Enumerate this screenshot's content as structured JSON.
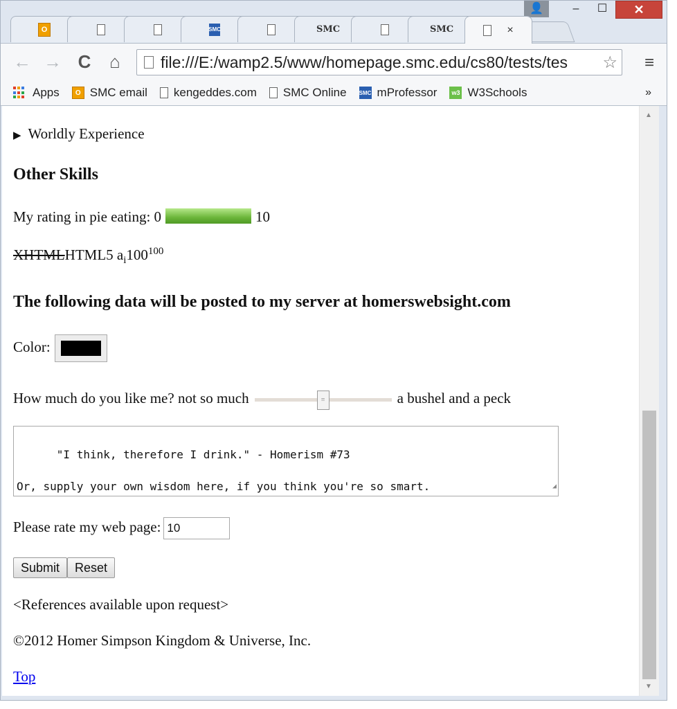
{
  "window": {
    "profile_glyph": "👤",
    "minimize": "–",
    "maximize": "☐",
    "close": "✕"
  },
  "tabs": [
    {
      "favicon": "office",
      "label": "O"
    },
    {
      "favicon": "doc",
      "label": ""
    },
    {
      "favicon": "doc",
      "label": ""
    },
    {
      "favicon": "smc",
      "label": "SMC"
    },
    {
      "favicon": "doc",
      "label": ""
    },
    {
      "favicon": "smc-text",
      "label": "SMC"
    },
    {
      "favicon": "doc",
      "label": ""
    },
    {
      "favicon": "smc-text",
      "label": "SMC"
    },
    {
      "favicon": "doc",
      "label": "",
      "active": true,
      "close": "×"
    }
  ],
  "toolbar": {
    "back": "←",
    "forward": "→",
    "reload": "C",
    "home": "⌂",
    "url": "file:///E:/wamp2.5/www/homepage.smc.edu/cs80/tests/tes",
    "star": "☆",
    "menu": "≡"
  },
  "bookmarks": [
    {
      "icon": "apps",
      "label": "Apps"
    },
    {
      "icon": "office",
      "label": "SMC email",
      "glyph": "O"
    },
    {
      "icon": "doc",
      "label": "kengeddes.com"
    },
    {
      "icon": "doc",
      "label": "SMC Online"
    },
    {
      "icon": "smc",
      "label": "mProfessor",
      "glyph": "SMC"
    },
    {
      "icon": "w3",
      "label": "W3Schools",
      "glyph": "w3"
    }
  ],
  "bookmarks_more": "»",
  "page": {
    "details_marker": "▶",
    "details_summary": "Worldly Experience",
    "other_skills_heading": "Other Skills",
    "pie_prefix": "My rating in pie eating: 0",
    "pie_suffix": "10",
    "pie_meter_value": 10,
    "pie_meter_max": 10,
    "xhtml": "XHTML",
    "html5_line": "HTML5 a",
    "sub_i": "i",
    "hundred": "100",
    "sup_100": "100",
    "post_heading": "The following data will be posted to my server at homerswebsight.com",
    "color_label": "Color:",
    "color_value": "#000000",
    "slider_label": "How much do you like me? not so much",
    "slider_suffix": "a bushel and a peck",
    "slider_value": 0.5,
    "textarea_value": "\"I think, therefore I drink.\" - Homerism #73\n\nOr, supply your own wisdom here, if you think you're so smart.",
    "rate_label": "Please rate my web page:",
    "rate_value": "10",
    "submit": "Submit",
    "reset": "Reset",
    "references": "<References available upon request>",
    "copyright": "©2012 Homer Simpson Kingdom & Universe, Inc.",
    "top_link": "Top"
  },
  "colors": {
    "meter_green": "#6bb53a",
    "link": "#0000ee",
    "close_red": "#c7443a"
  }
}
